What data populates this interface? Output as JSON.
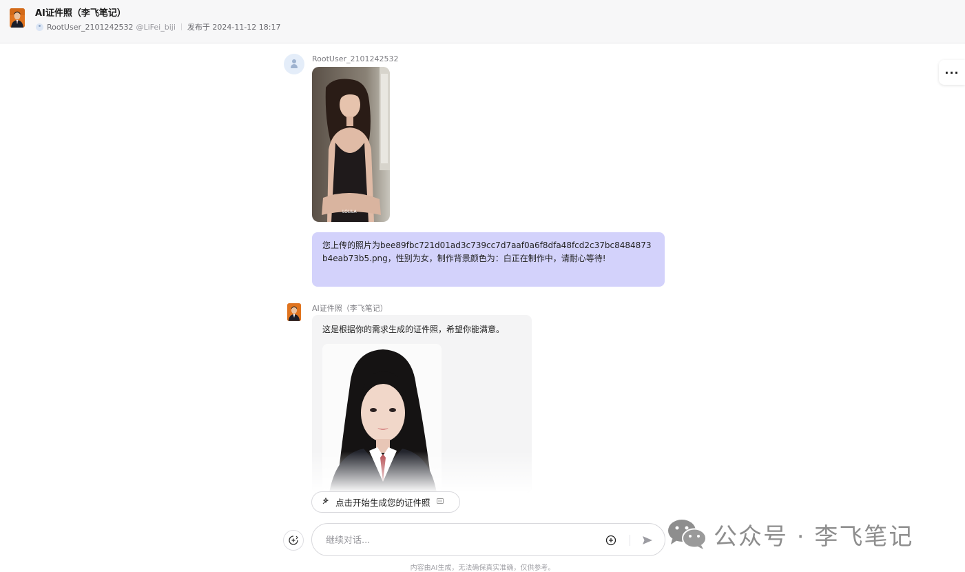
{
  "header": {
    "title": "AI证件照（李飞笔记）",
    "user": "RootUser_2101242532",
    "handle": "@LiFei_biji",
    "published": "发布于 2024-11-12 18:17"
  },
  "more_label": "···",
  "conversation": {
    "user_message": {
      "sender": "RootUser_2101242532",
      "text": "您上传的照片为bee89fbc721d01ad3c739cc7d7aaf0a6f8dfa48fcd2c37bc8484873b4eab73b5.png，性别为女，制作背景颜色为：白正在制作中，请耐心等待!"
    },
    "bot_message": {
      "sender": "AI证件照（李飞笔记）",
      "text": "这是根据你的需求生成的证件照，希望你能满意。"
    },
    "photo_caption": "LOLILA"
  },
  "suggestion": {
    "label": "点击开始生成您的证件照"
  },
  "composer": {
    "placeholder": "继续对话..."
  },
  "disclaimer": "内容由AI生成，无法确保真实准确，仅供参考。",
  "watermark": "公众号 · 李飞笔记",
  "colors": {
    "user_bubble": "#d3d2fb",
    "bot_bubble": "#f4f4f5",
    "header_bg": "#f7f7f8"
  }
}
